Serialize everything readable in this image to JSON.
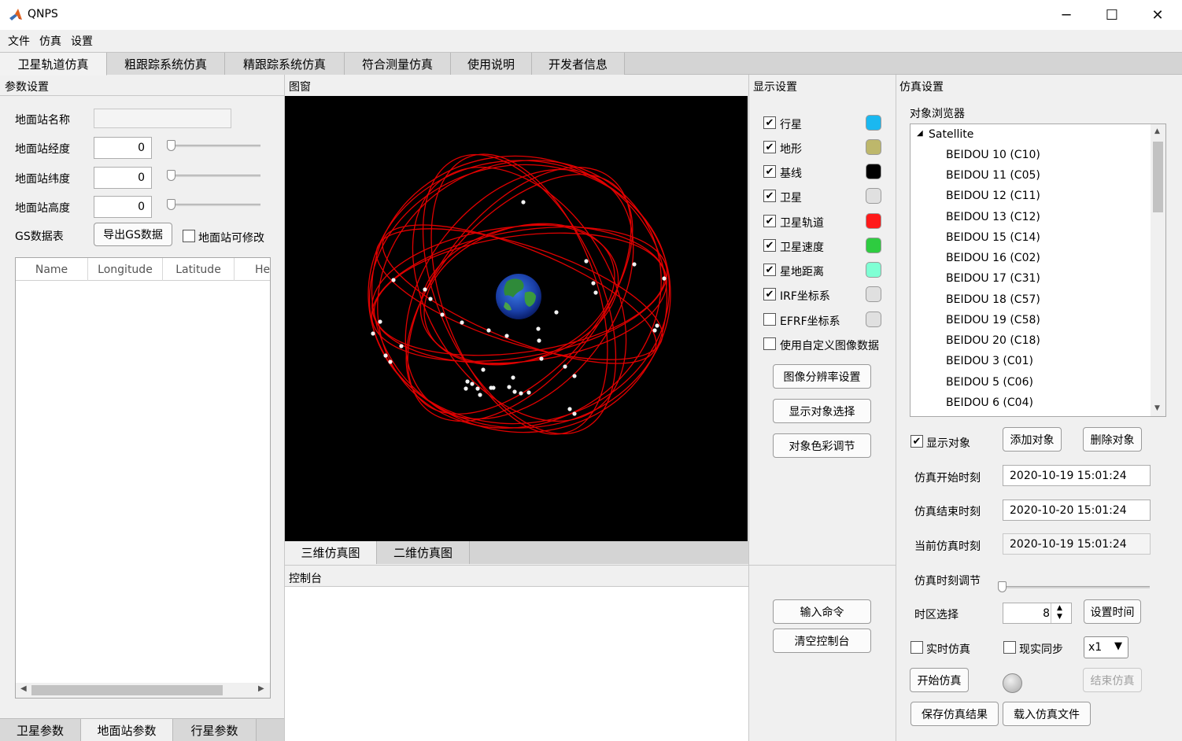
{
  "window": {
    "title": "QNPS",
    "minimize": "─",
    "maximize": "☐",
    "close": "✕"
  },
  "menu": [
    "文件",
    "仿真",
    "设置"
  ],
  "main_tabs": [
    "卫星轨道仿真",
    "粗跟踪系统仿真",
    "精跟踪系统仿真",
    "符合测量仿真",
    "使用说明",
    "开发者信息"
  ],
  "params": {
    "title": "参数设置",
    "station_name_label": "地面站名称",
    "station_name_value": "",
    "longitude_label": "地面站经度",
    "longitude_value": "0",
    "latitude_label": "地面站纬度",
    "latitude_value": "0",
    "altitude_label": "地面站高度",
    "altitude_value": "0",
    "gs_table_label": "GS数据表",
    "export_button": "导出GS数据",
    "editable_label": "地面站可修改",
    "columns": [
      "Name",
      "Longitude",
      "Latitude",
      "He"
    ],
    "bottom_tabs": [
      "卫星参数",
      "地面站参数",
      "行星参数"
    ]
  },
  "figure": {
    "title": "图窗",
    "tabs": [
      "三维仿真图",
      "二维仿真图"
    ]
  },
  "display": {
    "title": "显示设置",
    "items": [
      {
        "label": "行星",
        "checked": "✔",
        "color": "#1ab8f0"
      },
      {
        "label": "地形",
        "checked": "✔",
        "color": "#bdb76b"
      },
      {
        "label": "基线",
        "checked": "✔",
        "color": "#000000"
      },
      {
        "label": "卫星",
        "checked": "✔",
        "color": "#e0e0e0"
      },
      {
        "label": "卫星轨道",
        "checked": "✔",
        "color": "#ff1a1a"
      },
      {
        "label": "卫星速度",
        "checked": "✔",
        "color": "#2ecc40"
      },
      {
        "label": "星地距离",
        "checked": "✔",
        "color": "#7fffd4"
      },
      {
        "label": "IRF坐标系",
        "checked": "✔",
        "color": "#e0e0e0"
      },
      {
        "label": "EFRF坐标系",
        "checked": "",
        "color": "#e0e0e0"
      },
      {
        "label": "使用自定义图像数据",
        "checked": ""
      }
    ],
    "buttons": [
      "图像分辨率设置",
      "显示对象选择",
      "对象色彩调节"
    ]
  },
  "console": {
    "title": "控制台",
    "buttons": [
      "输入命令",
      "清空控制台"
    ]
  },
  "sim": {
    "title": "仿真设置",
    "browser_label": "对象浏览器",
    "tree_root": "Satellite",
    "tree_items": [
      "BEIDOU 10 (C10)",
      "BEIDOU 11 (C05)",
      "BEIDOU 12 (C11)",
      "BEIDOU 13 (C12)",
      "BEIDOU 15 (C14)",
      "BEIDOU 16 (C02)",
      "BEIDOU 17 (C31)",
      "BEIDOU 18 (C57)",
      "BEIDOU 19 (C58)",
      "BEIDOU 20 (C18)",
      "BEIDOU 3 (C01)",
      "BEIDOU 5 (C06)",
      "BEIDOU 6 (C04)"
    ],
    "show_object_label": "显示对象",
    "show_object_checked": "✔",
    "add_button": "添加对象",
    "delete_button": "删除对象",
    "start_time_label": "仿真开始时刻",
    "start_time": "2020-10-19 15:01:24",
    "end_time_label": "仿真结束时刻",
    "end_time": "2020-10-20 15:01:24",
    "current_time_label": "当前仿真时刻",
    "current_time": "2020-10-19 15:01:24",
    "time_adjust_label": "仿真时刻调节",
    "timezone_label": "时区选择",
    "timezone_value": "8",
    "set_time_button": "设置时间",
    "realtime_label": "实时仿真",
    "realsync_label": "现实同步",
    "speed_value": "x1",
    "start_button": "开始仿真",
    "stop_button": "结束仿真",
    "save_button": "保存仿真结果",
    "load_button": "载入仿真文件"
  }
}
